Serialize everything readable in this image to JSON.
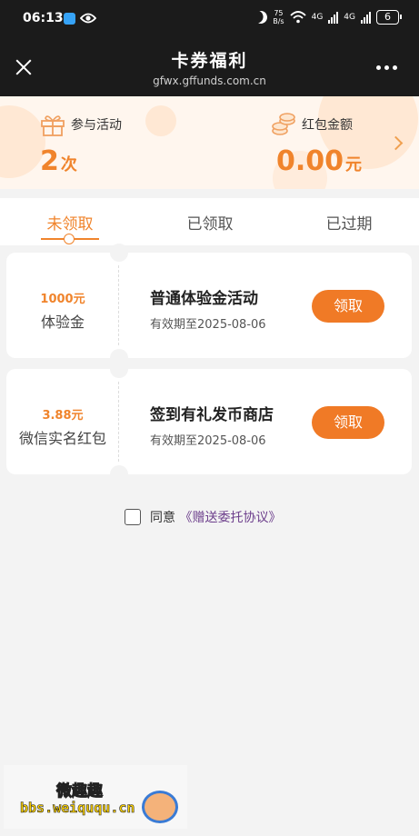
{
  "status_bar": {
    "time": "06:13",
    "net_speed_top": "75",
    "net_speed_bottom": "B/s",
    "sig1": "4G",
    "sig2": "4G",
    "battery": "6"
  },
  "header": {
    "title": "卡券福利",
    "subtitle": "gfwx.gffunds.com.cn"
  },
  "summary": {
    "activities_label": "参与活动",
    "activities_value": "2",
    "activities_unit": "次",
    "redpacket_label": "红包金额",
    "redpacket_value": "0.00",
    "redpacket_unit": "元"
  },
  "tabs": [
    {
      "label": "未领取",
      "active": true
    },
    {
      "label": "已领取",
      "active": false
    },
    {
      "label": "已过期",
      "active": false
    }
  ],
  "coupons": [
    {
      "amount": "1000元",
      "type": "体验金",
      "name": "普通体验金活动",
      "expiry": "有效期至2025-08-06",
      "button": "领取"
    },
    {
      "amount": "3.88元",
      "type": "微信实名红包",
      "name": "签到有礼发币商店",
      "expiry": "有效期至2025-08-06",
      "button": "领取"
    }
  ],
  "agreement": {
    "prefix": "同意",
    "link": "《赠送委托协议》"
  },
  "watermark": {
    "line1": "微趣趣",
    "line2": "bbs.weiququ.cn"
  },
  "colors": {
    "accent": "#f0842c",
    "button": "#f07a26",
    "link": "#6d3f8c"
  }
}
